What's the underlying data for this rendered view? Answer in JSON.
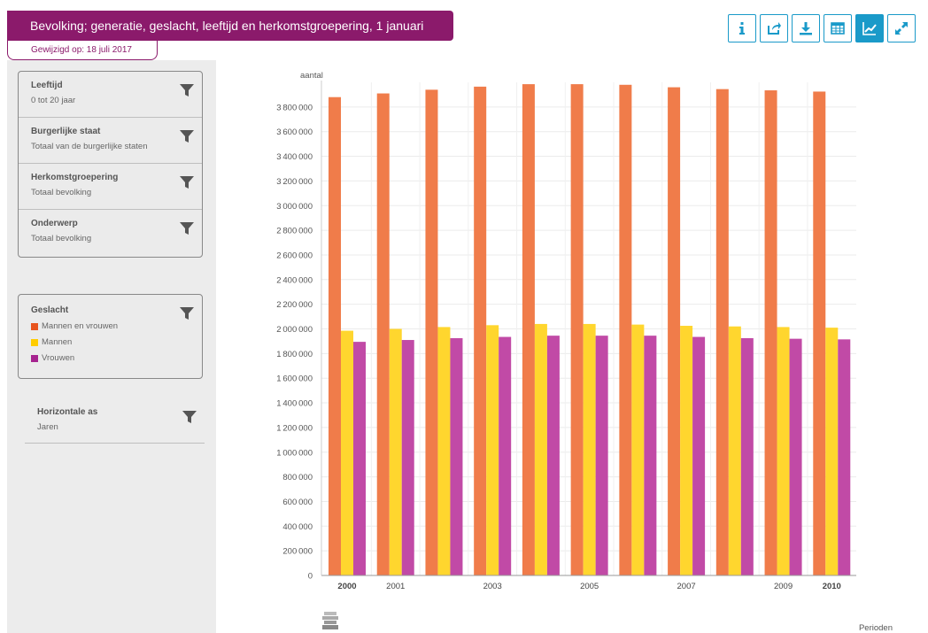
{
  "title": "Bevolking; generatie, geslacht, leeftijd en herkomstgroepering, 1 januari",
  "modified": "Gewijzigd op: 18 juli 2017",
  "toolbar": {
    "buttons": [
      {
        "name": "info-button",
        "icon": "info-icon"
      },
      {
        "name": "share-button",
        "icon": "share-icon"
      },
      {
        "name": "download-button",
        "icon": "download-icon"
      },
      {
        "name": "table-button",
        "icon": "table-icon"
      },
      {
        "name": "chart-button",
        "icon": "line-chart-icon",
        "active": true
      },
      {
        "name": "fullscreen-button",
        "icon": "expand-icon"
      }
    ],
    "accent": "#1a9ac9"
  },
  "filters": [
    {
      "title": "Leeftijd",
      "value": "0 tot 20 jaar"
    },
    {
      "title": "Burgerlijke staat",
      "value": "Totaal van de burgerlijke staten"
    },
    {
      "title": "Herkomstgroepering",
      "value": "Totaal bevolking"
    },
    {
      "title": "Onderwerp",
      "value": "Totaal bevolking"
    }
  ],
  "gender": {
    "title": "Geslacht",
    "items": [
      {
        "label": "Mannen en vrouwen",
        "color": "#e8541e"
      },
      {
        "label": "Mannen",
        "color": "#ffcc00"
      },
      {
        "label": "Vrouwen",
        "color": "#a6238f"
      }
    ]
  },
  "haxis": {
    "title": "Horizontale as",
    "value": "Jaren"
  },
  "chart_data": {
    "type": "bar",
    "ylabel": "aantal",
    "xlabel": "Perioden",
    "ylim": [
      0,
      4000000
    ],
    "ytick_step": 200000,
    "grid": true,
    "categories": [
      "2000",
      "2001",
      "2002",
      "2003",
      "2004",
      "2005",
      "2006",
      "2007",
      "2008",
      "2009",
      "2010"
    ],
    "xtick_labels": [
      {
        "label": "2000",
        "bold": true
      },
      {
        "label": "2001",
        "bold": false
      },
      {
        "label": "",
        "bold": false
      },
      {
        "label": "2003",
        "bold": false
      },
      {
        "label": "",
        "bold": false
      },
      {
        "label": "2005",
        "bold": false
      },
      {
        "label": "",
        "bold": false
      },
      {
        "label": "2007",
        "bold": false
      },
      {
        "label": "",
        "bold": false
      },
      {
        "label": "2009",
        "bold": false
      },
      {
        "label": "2010",
        "bold": true
      }
    ],
    "series": [
      {
        "name": "Mannen en vrouwen",
        "color": "#f07c4a",
        "values": [
          3880000,
          3910000,
          3940000,
          3965000,
          3985000,
          3985000,
          3980000,
          3960000,
          3945000,
          3935000,
          3925000
        ]
      },
      {
        "name": "Mannen",
        "color": "#ffd62e",
        "values": [
          1985000,
          2000000,
          2015000,
          2030000,
          2040000,
          2040000,
          2035000,
          2025000,
          2020000,
          2015000,
          2010000
        ]
      },
      {
        "name": "Vrouwen",
        "color": "#c14aa6",
        "values": [
          1895000,
          1910000,
          1925000,
          1935000,
          1945000,
          1945000,
          1945000,
          1935000,
          1925000,
          1920000,
          1915000
        ]
      }
    ]
  }
}
